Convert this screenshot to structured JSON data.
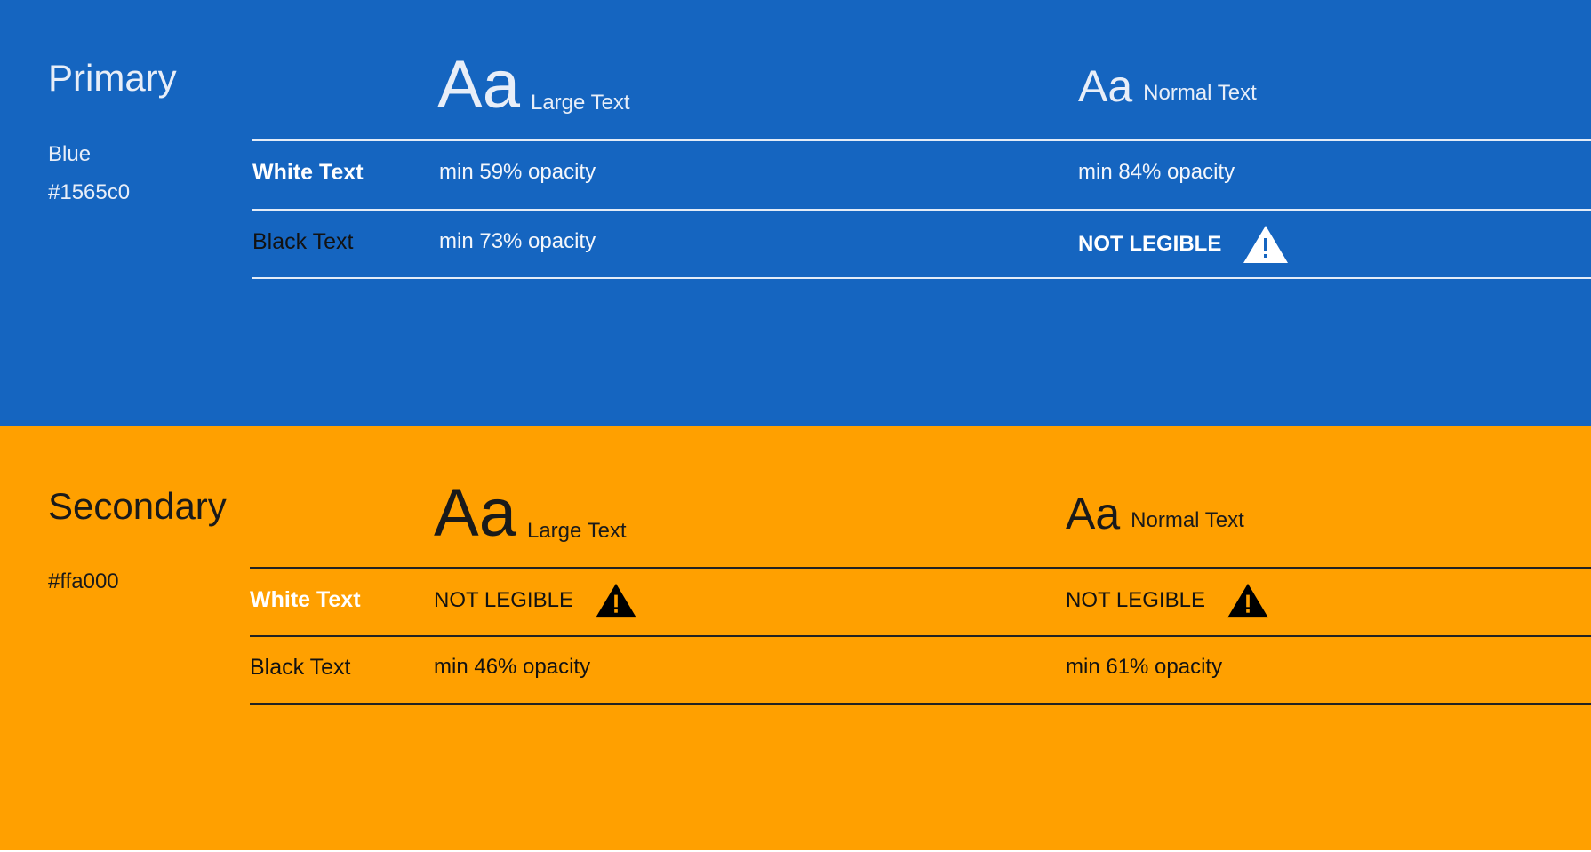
{
  "colors": {
    "primary_bg": "#1565c0",
    "secondary_bg": "#ffa000"
  },
  "primary": {
    "title": "Primary",
    "color_name": "Blue",
    "hex": "#1565c0",
    "large_sample": "Aa",
    "large_label": "Large Text",
    "normal_sample": "Aa",
    "normal_label": "Normal Text",
    "rows": [
      {
        "label": "White Text",
        "large": "min 59% opacity",
        "normal": "min 84% opacity"
      },
      {
        "label": "Black Text",
        "large": "min 73% opacity",
        "normal": "NOT LEGIBLE",
        "normal_icon": "warning-icon"
      }
    ]
  },
  "secondary": {
    "title": "Secondary",
    "hex": "#ffa000",
    "large_sample": "Aa",
    "large_label": "Large Text",
    "normal_sample": "Aa",
    "normal_label": "Normal Text",
    "rows": [
      {
        "label": "White Text",
        "large": "NOT LEGIBLE",
        "large_icon": "warning-icon",
        "normal": "NOT LEGIBLE",
        "normal_icon": "warning-icon"
      },
      {
        "label": "Black Text",
        "large": "min 46% opacity",
        "normal": "min 61% opacity"
      }
    ]
  }
}
